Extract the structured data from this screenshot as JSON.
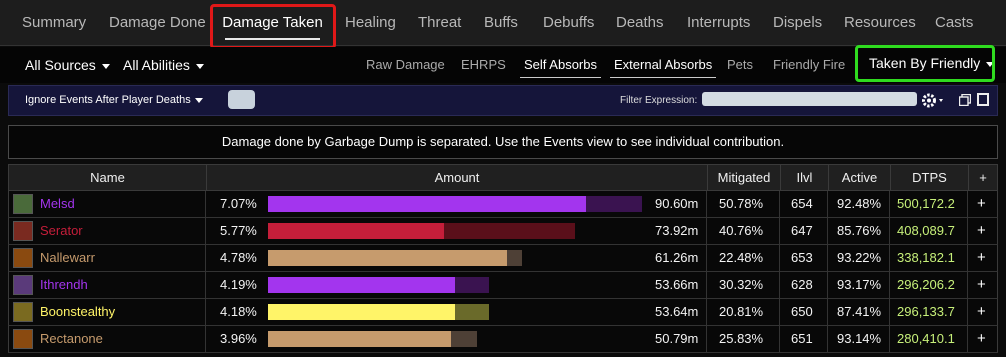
{
  "tabs": [
    {
      "label": "Summary",
      "active": false
    },
    {
      "label": "Damage Done",
      "active": false
    },
    {
      "label": "Damage Taken",
      "active": true
    },
    {
      "label": "Healing",
      "active": false
    },
    {
      "label": "Threat",
      "active": false
    },
    {
      "label": "Buffs",
      "active": false
    },
    {
      "label": "Debuffs",
      "active": false
    },
    {
      "label": "Deaths",
      "active": false
    },
    {
      "label": "Interrupts",
      "active": false
    },
    {
      "label": "Dispels",
      "active": false
    },
    {
      "label": "Resources",
      "active": false
    },
    {
      "label": "Casts",
      "active": false
    }
  ],
  "filters": {
    "sources": "All Sources",
    "abilities": "All Abilities",
    "views": [
      {
        "label": "Raw Damage",
        "active": false
      },
      {
        "label": "EHRPS",
        "active": false
      },
      {
        "label": "Self Absorbs",
        "active": true
      },
      {
        "label": "External Absorbs",
        "active": true
      },
      {
        "label": "Pets",
        "active": false
      },
      {
        "label": "Friendly Fire",
        "active": false
      }
    ],
    "taken_by": "Taken By Friendly"
  },
  "options": {
    "ignore_events": "Ignore Events After Player Deaths",
    "expression_label": "Filter Expression:",
    "expression_value": ""
  },
  "notice": "Damage done by Garbage Dump is separated. Use the Events view to see individual contribution.",
  "table": {
    "headers": {
      "name": "Name",
      "amount": "Amount",
      "mitigated": "Mitigated",
      "ilvl": "Ilvl",
      "active": "Active",
      "dtps": "DTPS",
      "plus": "+"
    },
    "rows": [
      {
        "name": "Melsd",
        "class_color": "#a335ee",
        "bar_bg": "#3a1350",
        "pct": "7.07%",
        "amount": "90.60m",
        "fill_fraction": 0.85,
        "total_fraction": 1.0,
        "mitigated": "50.78%",
        "ilvl": "654",
        "active": "92.48%",
        "dtps": "500,172.2",
        "icon_color": "#4a6a3a"
      },
      {
        "name": "Serator",
        "class_color": "#c41e3a",
        "bar_bg": "#5a0f1a",
        "pct": "5.77%",
        "amount": "73.92m",
        "fill_fraction": 0.47,
        "total_fraction": 0.82,
        "mitigated": "40.76%",
        "ilvl": "647",
        "active": "85.76%",
        "dtps": "408,089.7",
        "icon_color": "#7a2a20"
      },
      {
        "name": "Nallewarr",
        "class_color": "#c69b6d",
        "bar_bg": "#4e4036",
        "pct": "4.78%",
        "amount": "61.26m",
        "fill_fraction": 0.64,
        "total_fraction": 0.68,
        "mitigated": "22.48%",
        "ilvl": "653",
        "active": "93.22%",
        "dtps": "338,182.1",
        "icon_color": "#8a4a10"
      },
      {
        "name": "Ithrendh",
        "class_color": "#a335ee",
        "bar_bg": "#3a1350",
        "pct": "4.19%",
        "amount": "53.66m",
        "fill_fraction": 0.5,
        "total_fraction": 0.59,
        "mitigated": "30.32%",
        "ilvl": "628",
        "active": "93.17%",
        "dtps": "296,206.2",
        "icon_color": "#5a3a7a"
      },
      {
        "name": "Boonstealthy",
        "class_color": "#fff468",
        "bar_bg": "#6a6a2a",
        "pct": "4.18%",
        "amount": "53.64m",
        "fill_fraction": 0.5,
        "total_fraction": 0.59,
        "mitigated": "20.81%",
        "ilvl": "650",
        "active": "87.41%",
        "dtps": "296,133.7",
        "icon_color": "#7a6a20"
      },
      {
        "name": "Rectanone",
        "class_color": "#c69b6d",
        "bar_bg": "#4e4036",
        "pct": "3.96%",
        "amount": "50.79m",
        "fill_fraction": 0.49,
        "total_fraction": 0.56,
        "mitigated": "25.83%",
        "ilvl": "651",
        "active": "93.14%",
        "dtps": "280,410.1",
        "icon_color": "#8a4a10"
      }
    ]
  }
}
